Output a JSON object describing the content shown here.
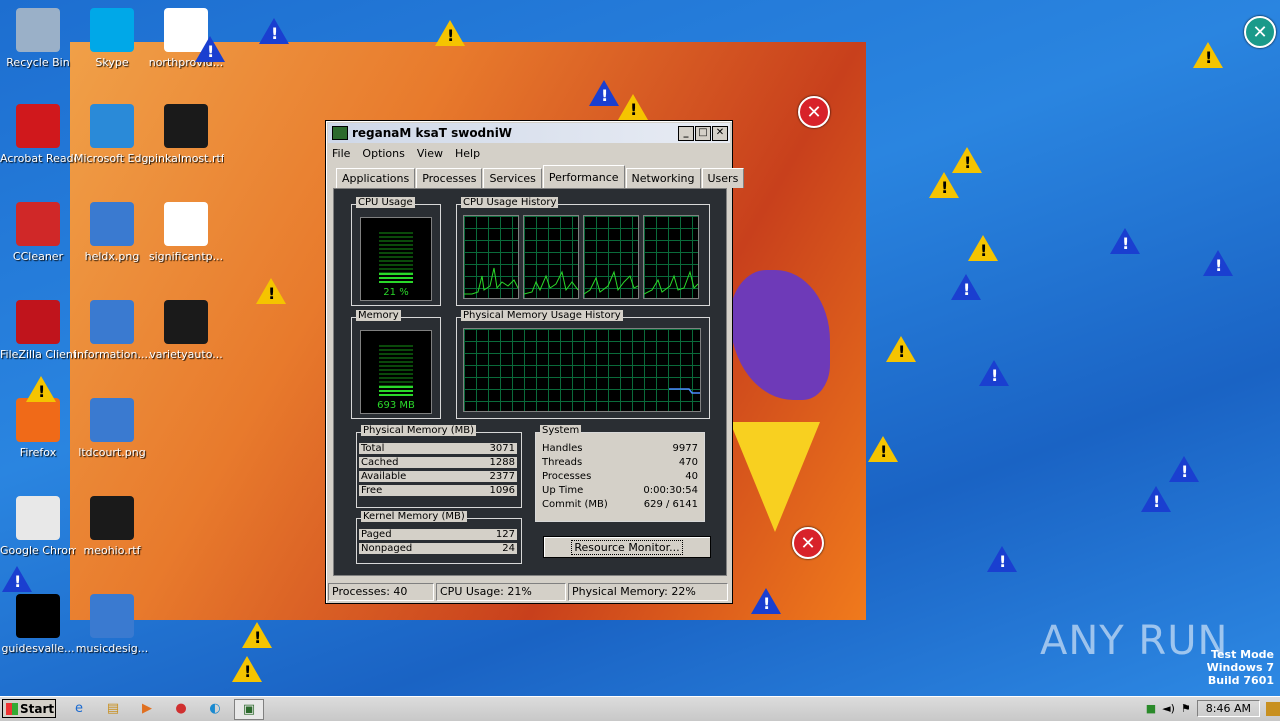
{
  "desktop": {
    "icons": [
      {
        "label": "Recycle Bin",
        "icon": "recycle-bin-icon",
        "color": "#9ab0c8"
      },
      {
        "label": "Skype",
        "icon": "skype-icon",
        "color": "#00a8e8"
      },
      {
        "label": "northprovid...",
        "icon": "word-doc-icon",
        "color": "#ffffff"
      },
      {
        "label": "Acrobat Reader DC",
        "icon": "acrobat-icon",
        "color": "#d0181c"
      },
      {
        "label": "Microsoft Edge",
        "icon": "edge-icon",
        "color": "#2a8ad8"
      },
      {
        "label": "pinkalmost.rtf",
        "icon": "rtf-icon",
        "color": "#1a1a1a"
      },
      {
        "label": "CCleaner",
        "icon": "ccleaner-icon",
        "color": "#d02828"
      },
      {
        "label": "heldx.png",
        "icon": "png-icon",
        "color": "#3a7ad0"
      },
      {
        "label": "significantp...",
        "icon": "file-icon",
        "color": "#ffffff"
      },
      {
        "label": "FileZilla Client",
        "icon": "filezilla-icon",
        "color": "#c0141c"
      },
      {
        "label": "information....",
        "icon": "file-icon",
        "color": "#3a7ad0"
      },
      {
        "label": "varietyauto...",
        "icon": "rtf-icon",
        "color": "#1a1a1a"
      },
      {
        "label": "Firefox",
        "icon": "firefox-icon",
        "color": "#f06a18"
      },
      {
        "label": "ltdcourt.png",
        "icon": "png-icon",
        "color": "#3a7ad0"
      },
      {
        "label": "Google Chrome",
        "icon": "chrome-icon",
        "color": "#e8e8e8"
      },
      {
        "label": "meohio.rtf",
        "icon": "rtf-icon",
        "color": "#1a1a1a"
      },
      {
        "label": "guidesvalle...",
        "icon": "file-icon",
        "color": "#000000"
      },
      {
        "label": "musicdesig...",
        "icon": "file-icon",
        "color": "#3a7ad0"
      }
    ]
  },
  "taskmanager": {
    "title": "reganaM ksaT swodniW",
    "menu": [
      "File",
      "Options",
      "View",
      "Help"
    ],
    "tabs": [
      "Applications",
      "Processes",
      "Services",
      "Performance",
      "Networking",
      "Users"
    ],
    "active_tab": "Performance",
    "cpu_usage": {
      "label": "CPU Usage",
      "value": "21 %",
      "level": 0.21
    },
    "cpu_history": {
      "label": "CPU Usage History"
    },
    "memory": {
      "label": "Memory",
      "value": "693 MB",
      "level": 0.22
    },
    "phys_history": {
      "label": "Physical Memory Usage History"
    },
    "physical_memory": {
      "label": "Physical Memory (MB)",
      "rows": [
        {
          "k": "Total",
          "v": "3071"
        },
        {
          "k": "Cached",
          "v": "1288"
        },
        {
          "k": "Available",
          "v": "2377"
        },
        {
          "k": "Free",
          "v": "1096"
        }
      ]
    },
    "kernel_memory": {
      "label": "Kernel Memory (MB)",
      "rows": [
        {
          "k": "Paged",
          "v": "127"
        },
        {
          "k": "Nonpaged",
          "v": "24"
        }
      ]
    },
    "system": {
      "label": "System",
      "rows": [
        {
          "k": "Handles",
          "v": "9977"
        },
        {
          "k": "Threads",
          "v": "470"
        },
        {
          "k": "Processes",
          "v": "40"
        },
        {
          "k": "Up Time",
          "v": "0:00:30:54"
        },
        {
          "k": "Commit (MB)",
          "v": "629 / 6141"
        }
      ]
    },
    "resource_monitor": "Resource Monitor...",
    "status": {
      "processes": "Processes: 40",
      "cpu": "CPU Usage: 21%",
      "memory": "Physical Memory: 22%"
    }
  },
  "taskbar": {
    "start": "Start",
    "clock": "8:46 AM"
  },
  "watermark": "ANY RUN",
  "testmode": {
    "line1": "Test Mode",
    "line2": "Windows 7",
    "line3": "Build 7601"
  }
}
